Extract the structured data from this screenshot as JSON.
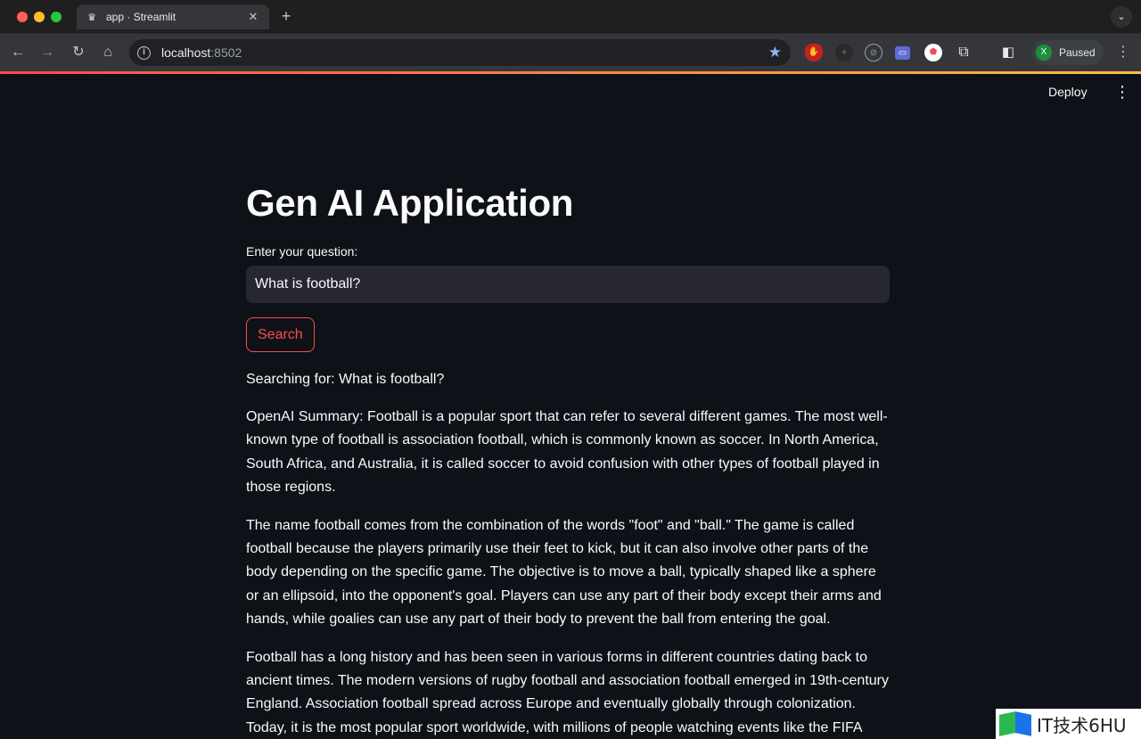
{
  "browser": {
    "tab_title": "app · Streamlit",
    "tab_favicon": "♛",
    "new_tab": "+",
    "url_host": "localhost",
    "url_port": ":8502",
    "profile_initial": "X",
    "profile_status": "Paused"
  },
  "app": {
    "deploy_label": "Deploy",
    "title": "Gen AI Application",
    "input_label": "Enter your question:",
    "input_value": "What is football?",
    "search_label": "Search",
    "searching_text": "Searching for: What is football?",
    "paragraphs": [
      "OpenAI Summary: Football is a popular sport that can refer to several different games. The most well-known type of football is association football, which is commonly known as soccer. In North America, South Africa, and Australia, it is called soccer to avoid confusion with other types of football played in those regions.",
      "The name football comes from the combination of the words \"foot\" and \"ball.\" The game is called football because the players primarily use their feet to kick, but it can also involve other parts of the body depending on the specific game. The objective is to move a ball, typically shaped like a sphere or an ellipsoid, into the opponent's goal. Players can use any part of their body except their arms and hands, while goalies can use any part of their body to prevent the ball from entering the goal.",
      "Football has a long history and has been seen in various forms in different countries dating back to ancient times. The modern versions of rugby football and association football emerged in 19th-century England. Association football spread across Europe and eventually globally through colonization. Today, it is the most popular sport worldwide, with millions of people watching events like the FIFA World Cup"
    ]
  },
  "watermark": {
    "text": "IT技术6HU"
  },
  "colors": {
    "background": "#0e1117",
    "accent": "#ff4b4b",
    "input_bg": "#262730"
  },
  "icons": [
    "back-arrow-icon",
    "forward-arrow-icon",
    "reload-icon",
    "home-icon",
    "site-info-icon",
    "bookmark-star-icon",
    "extensions-icon",
    "side-panel-icon",
    "kebab-menu-icon"
  ]
}
